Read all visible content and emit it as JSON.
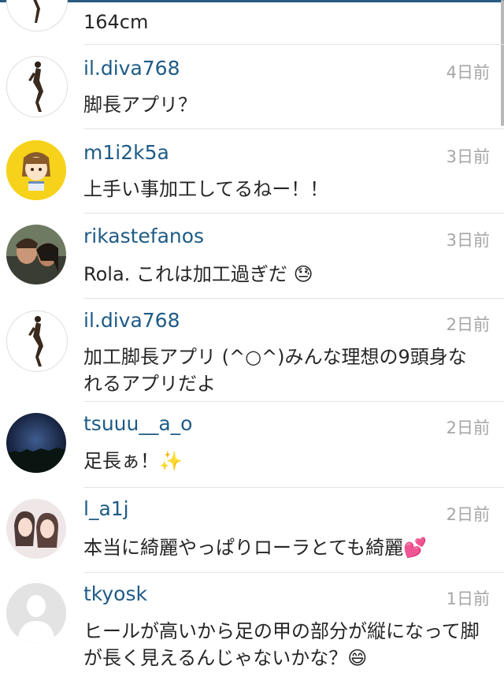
{
  "first_comment": {
    "text": "164cm"
  },
  "comments": [
    {
      "username": "il.diva768",
      "time": "4日前",
      "text": "脚長アプリ？",
      "avatar": "silhouette-dancer-avatar"
    },
    {
      "username": "m1i2k5a",
      "time": "3日前",
      "text": "上手い事加工してるねー！！",
      "avatar": "cartoon-girl-avatar"
    },
    {
      "username": "rikastefanos",
      "time": "3日前",
      "text": "Rola. これは加工過ぎだ",
      "emoji": "😓",
      "avatar": "couple-photo-avatar"
    },
    {
      "username": "il.diva768",
      "time": "2日前",
      "text": "加工脚長アプリ (^○^)みんな理想の9頭身なれるアプリだよ",
      "avatar": "silhouette-dancer-avatar"
    },
    {
      "username": "tsuuu__a_o",
      "time": "2日前",
      "text": "足長ぁ！",
      "emoji": "✨",
      "avatar": "night-sky-avatar"
    },
    {
      "username": "l_a1j",
      "time": "2日前",
      "text": "本当に綺麗やっぱりローラとても綺麗",
      "emoji": "💕",
      "avatar": "two-girls-avatar"
    },
    {
      "username": "tkyosk",
      "time": "1日前",
      "text": "ヒールが高いから足の甲の部分が縦になって脚が長く見えるんじゃないかな？",
      "emoji": "😄",
      "avatar": "default-person-avatar"
    }
  ]
}
